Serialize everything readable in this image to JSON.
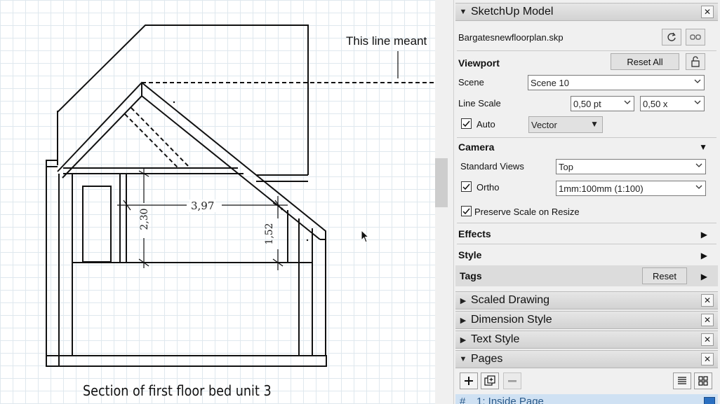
{
  "drawing": {
    "callout": "This line meant",
    "caption": "Section of first floor bed unit 3",
    "dimensions": {
      "width_label": "3,97",
      "height_left": "2,30",
      "height_right": "1,52"
    }
  },
  "panel": {
    "tray_title": "SketchUp Model",
    "file_name": "Bargatesnewfloorplan.skp",
    "viewport": {
      "title": "Viewport",
      "reset_all": "Reset All",
      "scene_label": "Scene",
      "scene_value": "Scene 10",
      "line_scale_label": "Line Scale",
      "line_scale_pt": "0,50 pt",
      "line_scale_x": "0,50 x",
      "auto_label": "Auto",
      "auto_checked": true,
      "render_mode": "Vector"
    },
    "camera": {
      "title": "Camera",
      "standard_views_label": "Standard Views",
      "standard_views_value": "Top",
      "ortho_label": "Ortho",
      "ortho_checked": true,
      "ortho_scale": "1mm:100mm (1:100)",
      "preserve_scale_label": "Preserve Scale on Resize",
      "preserve_checked": true
    },
    "sections": {
      "effects": "Effects",
      "style": "Style",
      "tags": "Tags",
      "tags_reset": "Reset"
    },
    "trays": {
      "scaled_drawing": "Scaled Drawing",
      "dimension_style": "Dimension Style",
      "text_style": "Text Style",
      "pages": "Pages"
    },
    "pages": {
      "first_page": "1: Inside Page",
      "first_page_hash": "#"
    }
  },
  "colors": {
    "canvas_grid": "#dfe8ee",
    "panel_bg": "#f0f0f0",
    "selected_page": "#cfe1f3",
    "accent_blue": "#2a6fc1"
  },
  "icons": [
    "refresh-icon",
    "unlink-icon",
    "unlock-icon",
    "add-icon",
    "duplicate-icon",
    "remove-icon",
    "list-view-icon",
    "grid-view-icon",
    "close-icon",
    "mouse-cursor-icon"
  ]
}
